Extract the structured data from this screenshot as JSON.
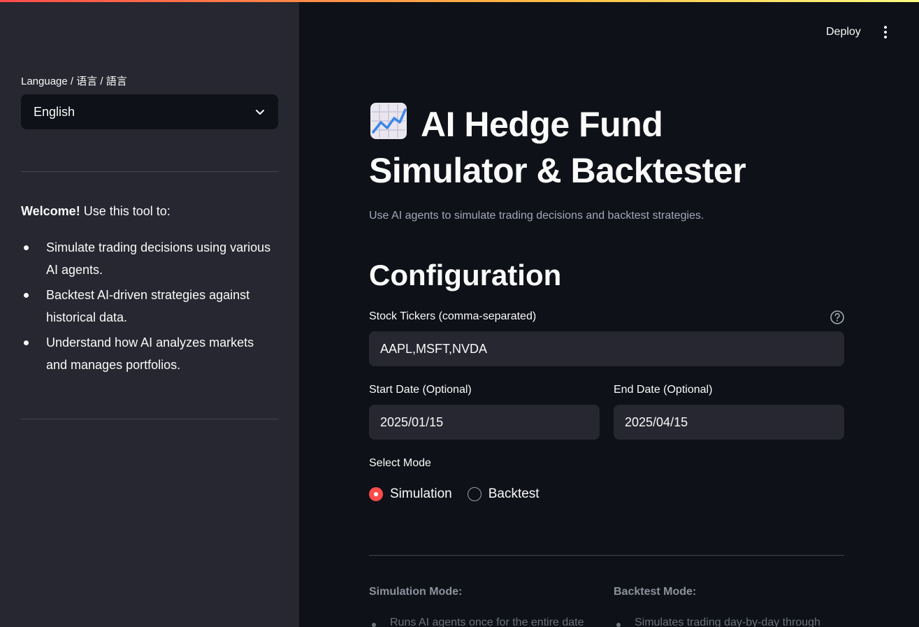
{
  "app": {
    "deploy_label": "Deploy"
  },
  "sidebar": {
    "language_label": "Language / 语言 / 語言",
    "language_value": "English",
    "welcome_bold": "Welcome!",
    "welcome_text": " Use this tool to:",
    "items": [
      "Simulate trading decisions using various AI agents.",
      "Backtest AI-driven strategies against historical data.",
      "Understand how AI analyzes markets and manages portfolios."
    ]
  },
  "main": {
    "title_line1": "AI Hedge Fund",
    "title_line2": "Simulator & Backtester",
    "title_icon": "chart-increasing-emoji",
    "subtitle": "Use AI agents to simulate trading decisions and backtest strategies.",
    "config_heading": "Configuration",
    "tickers_label": "Stock Tickers (comma-separated)",
    "tickers_value": "AAPL,MSFT,NVDA",
    "start_label": "Start Date (Optional)",
    "start_value": "2025/01/15",
    "end_label": "End Date (Optional)",
    "end_value": "2025/04/15",
    "mode_label": "Select Mode",
    "modes": [
      "Simulation",
      "Backtest"
    ],
    "selected_mode": "Simulation",
    "simulation_mode_title": "Simulation Mode:",
    "backtest_mode_title": "Backtest Mode:",
    "simulation_mode_item": "Runs AI agents once for the entire date",
    "backtest_mode_item": "Simulates trading day-by-day through"
  },
  "colors": {
    "background": "#0e1117",
    "sidebar": "#262730",
    "accent": "#ff4b4b"
  }
}
